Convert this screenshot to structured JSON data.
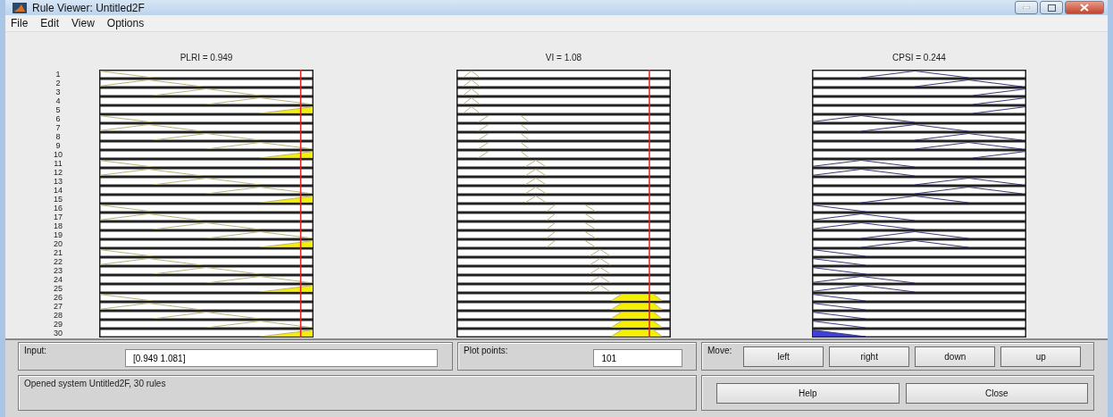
{
  "window": {
    "title": "Rule Viewer: Untitled2F"
  },
  "menu": [
    "File",
    "Edit",
    "View",
    "Options"
  ],
  "plots": [
    {
      "title": "PLRI = 0.949",
      "kind": "input"
    },
    {
      "title": "VI = 1.08",
      "kind": "input"
    },
    {
      "title": "CPSI = 0.244",
      "kind": "output"
    }
  ],
  "rules": [
    "1",
    "2",
    "3",
    "4",
    "5",
    "6",
    "7",
    "8",
    "9",
    "10",
    "11",
    "12",
    "13",
    "14",
    "15",
    "16",
    "17",
    "18",
    "19",
    "20",
    "21",
    "22",
    "23",
    "24",
    "25",
    "26",
    "27",
    "28",
    "29",
    "30"
  ],
  "input": {
    "label": "Input:",
    "value": "[0.949 1.081]"
  },
  "plot_points": {
    "label": "Plot points:",
    "value": "101"
  },
  "move": {
    "label": "Move:",
    "buttons": [
      "left",
      "right",
      "down",
      "up"
    ]
  },
  "status": "Opened system Untitled2F, 30 rules",
  "buttons": [
    "Help",
    "Close"
  ]
}
